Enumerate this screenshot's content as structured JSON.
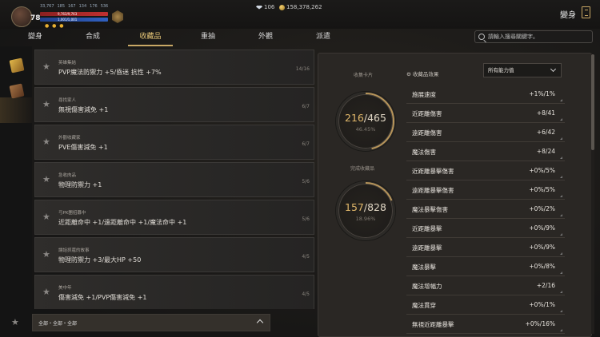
{
  "player": {
    "level": "78",
    "stats": [
      "33,767",
      "185",
      "167",
      "134",
      "176",
      "536"
    ],
    "hp_text": "9,763/9,763",
    "mp_text": "1,001/1,001",
    "hp_fraction": 1.0,
    "mp_fraction": 1.0
  },
  "currency": {
    "gems": "106",
    "gold": "158,378,262"
  },
  "page_title": "變身",
  "tabs": [
    {
      "label": "變身",
      "active": false
    },
    {
      "label": "合成",
      "active": false
    },
    {
      "label": "收藏品",
      "active": true
    },
    {
      "label": "重抽",
      "active": false
    },
    {
      "label": "外觀",
      "active": false
    },
    {
      "label": "派遣",
      "active": false
    }
  ],
  "search": {
    "placeholder": "請輸入搜尋關鍵字。"
  },
  "collections": [
    {
      "category": "英雄集結",
      "effect": "PVP魔法防禦力 +5/昏迷 抗性 +7%",
      "progress": "14/16"
    },
    {
      "category": "尋找家人",
      "effect": "無視傷害減免 +1",
      "progress": "6/7"
    },
    {
      "category": "外觀收藏家",
      "effect": "PVE傷害減免 +1",
      "progress": "6/7"
    },
    {
      "category": "急收肉品",
      "effect": "物理防禦力 +1",
      "progress": "5/6"
    },
    {
      "category": "弓PK團招募中",
      "effect": "近距離命中 +1/遠距離命中 +1/魔法命中 +1",
      "progress": "5/6"
    },
    {
      "category": "讓話抓蔻的故事",
      "effect": "物理防禦力 +3/最大HP +50",
      "progress": "4/5"
    },
    {
      "category": "美中年",
      "effect": "傷害減免 +1/PVP傷害減免 +1",
      "progress": "4/5"
    }
  ],
  "filter": {
    "label": "全部・全部・全部"
  },
  "summary": {
    "cards_label": "收集卡片",
    "cards_count": "216",
    "cards_total": "/465",
    "cards_pct": "46.45%",
    "cards_fraction": 0.4645,
    "done_label": "完成收藏品",
    "done_count": "157",
    "done_total": "/828",
    "done_pct": "18.96%",
    "done_fraction": 0.1896
  },
  "effects": {
    "label": "收藏品效果",
    "dropdown": "所有能力值",
    "rows": [
      {
        "name": "施展速度",
        "value": "+1%/1%"
      },
      {
        "name": "近距離傷害",
        "value": "+8/41"
      },
      {
        "name": "遠距離傷害",
        "value": "+6/42"
      },
      {
        "name": "魔法傷害",
        "value": "+8/24"
      },
      {
        "name": "近距離暴擊傷害",
        "value": "+0%/5%"
      },
      {
        "name": "遠距離暴擊傷害",
        "value": "+0%/5%"
      },
      {
        "name": "魔法暴擊傷害",
        "value": "+0%/2%"
      },
      {
        "name": "近距離暴擊",
        "value": "+0%/9%"
      },
      {
        "name": "遠距離暴擊",
        "value": "+0%/9%"
      },
      {
        "name": "魔法暴擊",
        "value": "+0%/8%"
      },
      {
        "name": "魔法增幅力",
        "value": "+2/16"
      },
      {
        "name": "魔法貫穿",
        "value": "+0%/1%"
      },
      {
        "name": "無視近距離暴擊",
        "value": "+0%/16%"
      }
    ]
  }
}
